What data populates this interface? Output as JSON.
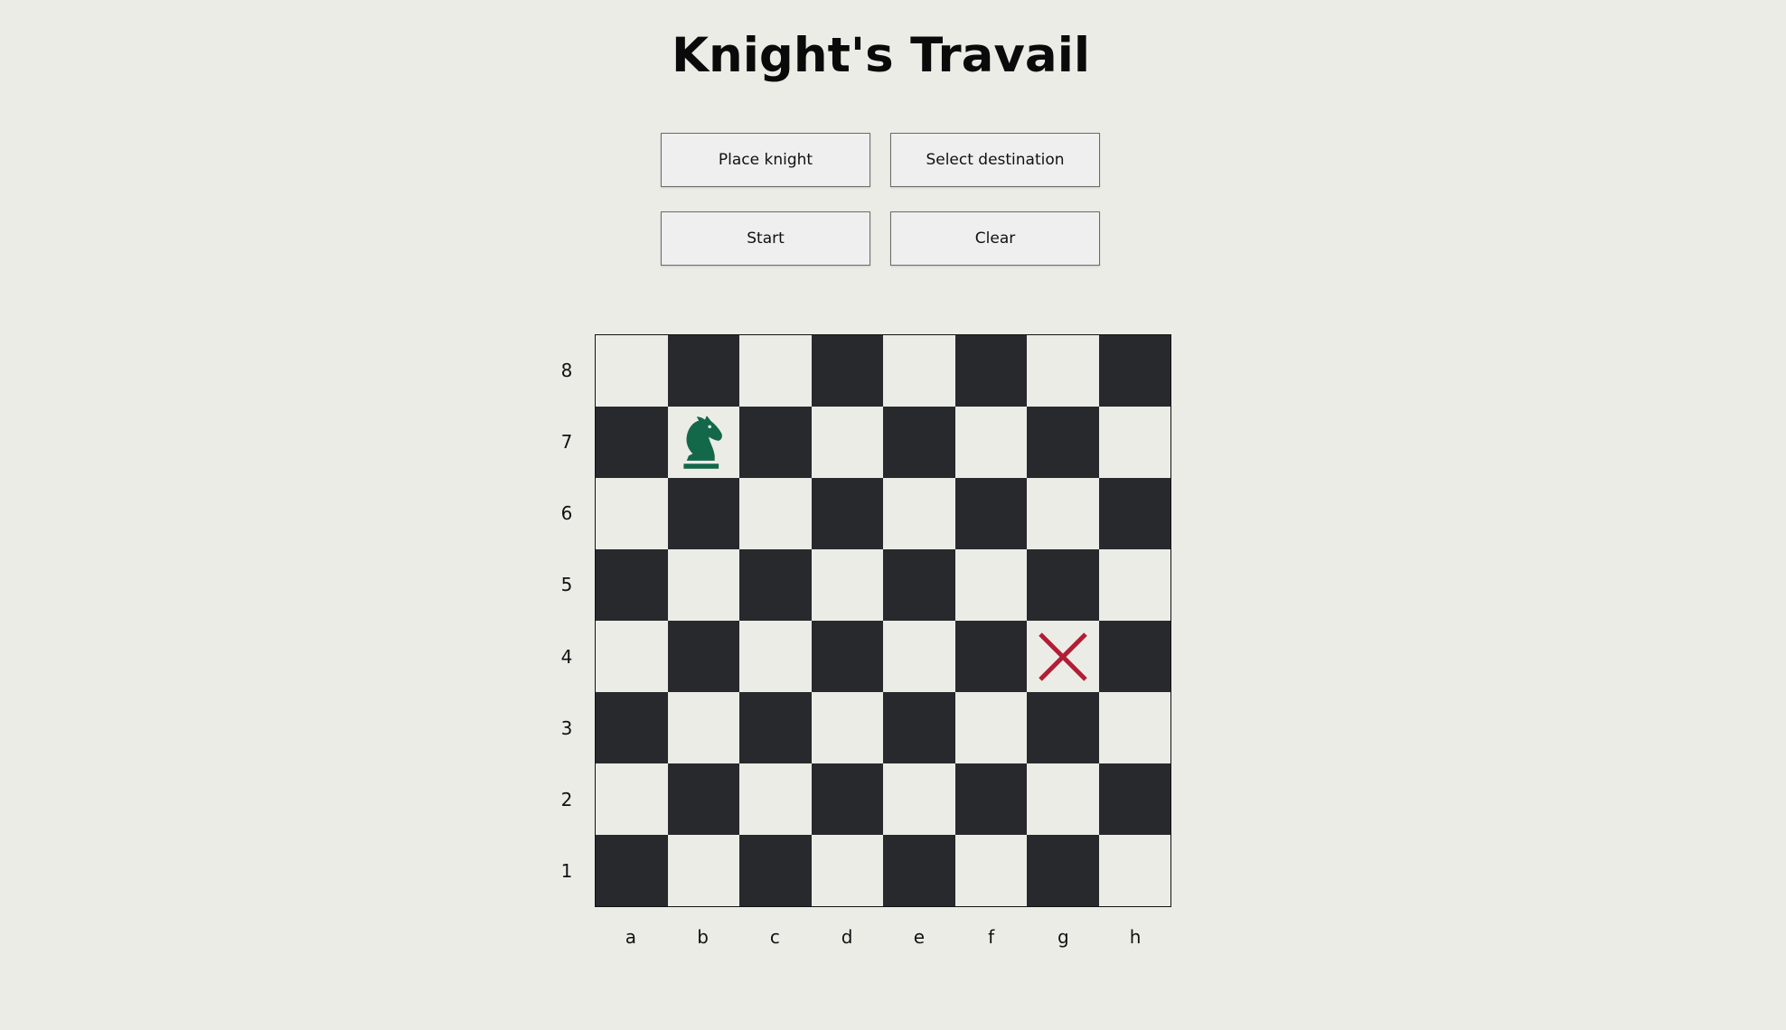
{
  "title": "Knight's Travail",
  "buttons": {
    "place_knight": "Place knight",
    "select_destination": "Select destination",
    "start": "Start",
    "clear": "Clear"
  },
  "board": {
    "files": [
      "a",
      "b",
      "c",
      "d",
      "e",
      "f",
      "g",
      "h"
    ],
    "ranks": [
      "8",
      "7",
      "6",
      "5",
      "4",
      "3",
      "2",
      "1"
    ],
    "knight_square": "b7",
    "destination_square": "g4",
    "knight_icon": "chess-knight-icon",
    "destination_icon": "x-mark-icon",
    "colors": {
      "light": "#ecece7",
      "dark": "#28292d",
      "knight": "#14684a",
      "destination": "#b21e35"
    }
  }
}
